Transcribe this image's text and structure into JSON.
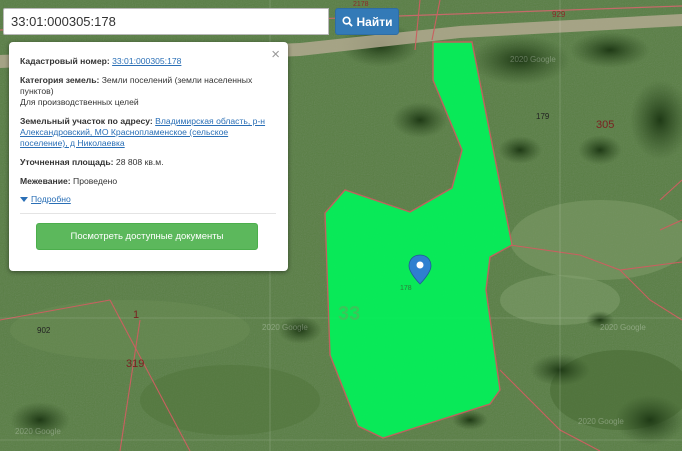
{
  "search": {
    "value": "33:01:000305:178",
    "button_label": "Найти"
  },
  "popup": {
    "cadastral_label": "Кадастровый номер:",
    "cadastral_value": "33:01:000305:178",
    "category_label": "Категория земель:",
    "category_value": "Земли поселений (земли населенных пунктов)",
    "purpose": "Для производственных целей",
    "address_label": "Земельный участок по адресу:",
    "address_value": "Владимирская область, р-н Александровский, МО Краснопламенское (сельское поселение), д Николаевка",
    "area_label": "Уточненная площадь:",
    "area_value": "28 808 кв.м.",
    "survey_label": "Межевание:",
    "survey_value": "Проведено",
    "details_link": "Подробно",
    "docs_button": "Посмотреть доступные документы",
    "close_symbol": "×"
  },
  "map_labels": {
    "parcel_number": "178",
    "block_number": "33",
    "road_929": "929",
    "road_2178": "2178",
    "n179": "179",
    "n305": "305",
    "n902": "902",
    "n1": "1",
    "n319": "319"
  },
  "watermarks": {
    "w1": "2020 Google",
    "w2": "2020 Google",
    "w3": "2020 Google",
    "w4": "2020 Google",
    "w5": "2020 Google"
  },
  "colors": {
    "parcel_fill": "#00f55a",
    "boundary": "#c96060",
    "button_blue": "#337ab7",
    "button_green": "#5cb85c",
    "marker": "#2f7fd0"
  },
  "icons": {
    "search_button": "search-icon",
    "marker": "map-marker-icon",
    "close": "close-icon",
    "details": "caret-down-icon"
  }
}
